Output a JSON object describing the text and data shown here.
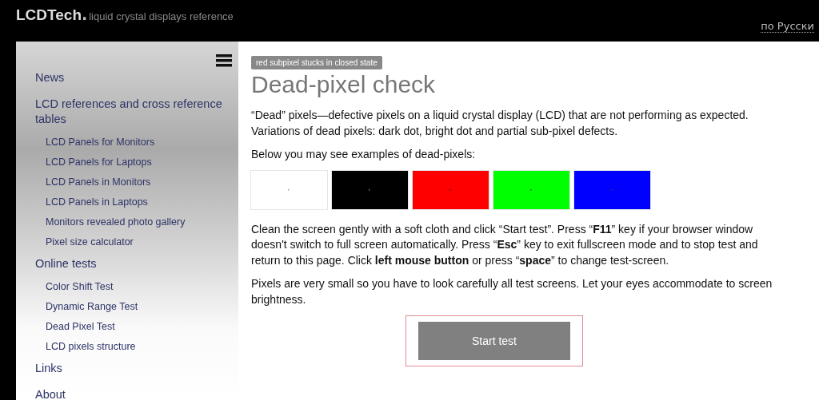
{
  "header": {
    "logo": "LCDTech",
    "logo_dot": ".",
    "tagline": "liquid crystal displays reference",
    "language_link": "по Русски"
  },
  "sidebar": {
    "items": [
      {
        "label": "News"
      },
      {
        "label": "LCD references and cross reference tables",
        "children": [
          {
            "label": "LCD Panels for Monitors"
          },
          {
            "label": "LCD Panels for Laptops"
          },
          {
            "label": "LCD Panels in Monitors"
          },
          {
            "label": "LCD Panels in Laptops"
          },
          {
            "label": "Monitors revealed photo gallery"
          },
          {
            "label": "Pixel size calculator"
          }
        ]
      },
      {
        "label": "Online tests",
        "children": [
          {
            "label": "Color Shift Test"
          },
          {
            "label": "Dynamic Range Test"
          },
          {
            "label": "Dead Pixel Test"
          },
          {
            "label": "LCD pixels structure"
          }
        ]
      },
      {
        "label": "Links"
      },
      {
        "label": "About"
      }
    ]
  },
  "content": {
    "badge": "red subpixel stucks in closed state",
    "title": "Dead-pixel check",
    "intro": "“Dead” pixels—defective pixels on a liquid crystal display (LCD) that are not performing as expected. Variations of dead pixels: dark dot, bright dot and partial sub-pixel defects.",
    "examples_label": "Below you may see examples of dead-pixels:",
    "swatches": [
      {
        "color": "#ffffff"
      },
      {
        "color": "#000000"
      },
      {
        "color": "#ff0000"
      },
      {
        "color": "#00ff00"
      },
      {
        "color": "#0000ff"
      }
    ],
    "instructions": "Clean the screen gently with a soft cloth and click “Start test”. Press “**F11**” key if your browser window doesn't switch to full screen automatically. Press “**Esc**” key to exit fullscreen mode and to stop test and return to this page. Click **left mouse button** or press “**space**” to change test-screen.",
    "note": "Pixels are very small so you have to look carefully all test screens. Let your eyes accommodate to screen brightness.",
    "button": "Start test"
  }
}
